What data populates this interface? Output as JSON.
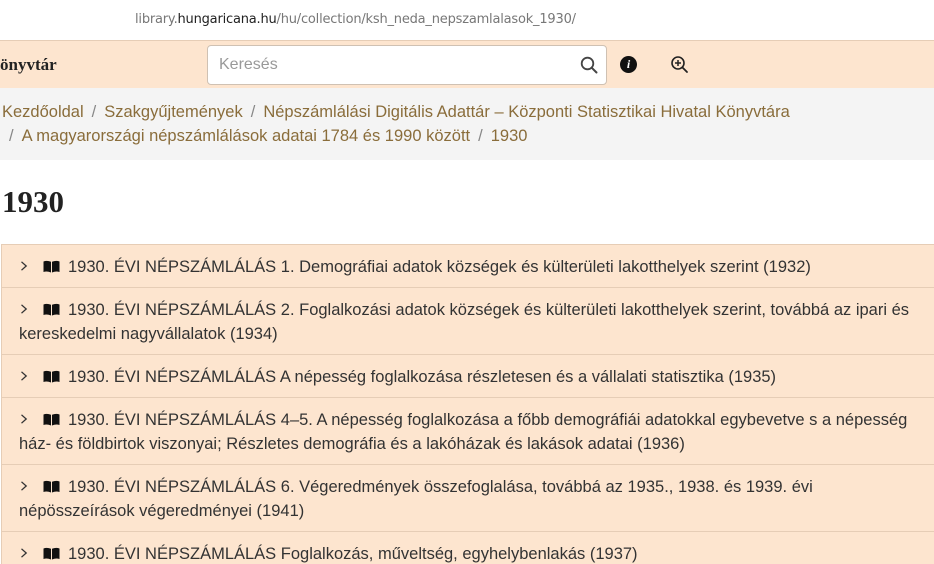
{
  "url": {
    "prefix": "library.",
    "host": "hungaricana.hu",
    "path": "/hu/collection/ksh_neda_nepszamlalasok_1930/"
  },
  "header": {
    "brand": "önyvtár",
    "search_placeholder": "Keresés"
  },
  "breadcrumb": {
    "items": [
      "Kezdőoldal",
      "Szakgyűjtemények",
      "Népszámlálási Digitális Adattár – Központi Statisztikai Hivatal Könyvtára",
      "A magyarországi népszámlálások adatai 1784 és 1990 között",
      "1930"
    ],
    "separator": "/"
  },
  "page": {
    "title": "1930"
  },
  "list": {
    "items": [
      "1930. ÉVI NÉPSZÁMLÁLÁS 1. Demográfiai adatok községek és külterületi lakotthelyek szerint (1932)",
      "1930. ÉVI NÉPSZÁMLÁLÁS 2. Foglalkozási adatok községek és külterületi lakotthelyek szerint, továbbá az ipari és kereskedelmi nagyvállalatok (1934)",
      "1930. ÉVI NÉPSZÁMLÁLÁS A népesség foglalkozása részletesen és a vállalati statisztika (1935)",
      "1930. ÉVI NÉPSZÁMLÁLÁS 4–5. A népesség foglalkozása a főbb demográfiái adatokkal egybevetve s a népesség ház- és földbirtok viszonyai; Részletes demográfia és a lakóházak és lakások adatai (1936)",
      "1930. ÉVI NÉPSZÁMLÁLÁS 6. Végeredmények összefoglalása, továbbá az 1935., 1938. és 1939. évi népösszeírások végeredményei (1941)",
      "1930. ÉVI NÉPSZÁMLÁLÁS Foglalkozás, műveltség, egyhelybenlakás (1937)"
    ]
  },
  "colors": {
    "header_bg": "#fde5cf",
    "link": "#8a6d3b",
    "breadcrumb_bg": "#f4f4f4"
  }
}
